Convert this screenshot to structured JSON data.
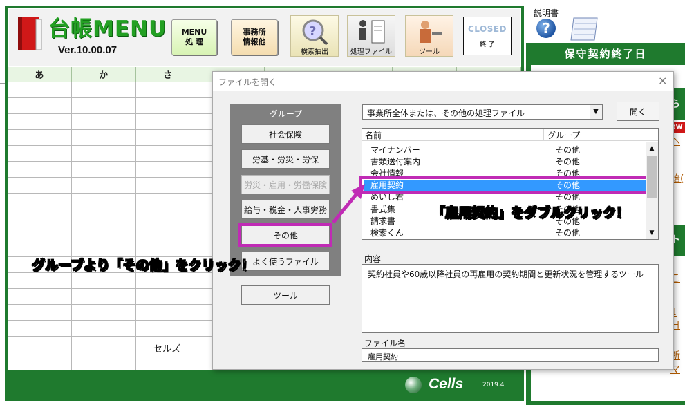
{
  "app": {
    "title": "台帳MENU",
    "version": "Ver.10.00.07"
  },
  "toolbar": {
    "menu_btn_line1": "MENU",
    "menu_btn_line2": "処 理",
    "office_btn_line1": "事務所",
    "office_btn_line2": "情報他",
    "search_label": "検索抽出",
    "process_label": "処理ファイル",
    "tool_label": "ツール",
    "closed_top": "CLOSED",
    "closed_label": "終 了"
  },
  "grid": {
    "columns": [
      "あ",
      "か",
      "さ"
    ],
    "cell_text": "セルズ"
  },
  "footer": {
    "brand": "Cells",
    "year": "2019.4"
  },
  "right": {
    "manual_label": "説明書",
    "panel_title": "保守契約終了日",
    "fragments": [
      "ら",
      "ew",
      "ヘ",
      "始(",
      "ト",
      "こ",
      "1日",
      "新マ"
    ]
  },
  "dialog": {
    "title": "ファイルを開く",
    "close": "×",
    "group_label": "グループ",
    "groups": [
      {
        "label": "社会保険",
        "enabled": true
      },
      {
        "label": "労基・労災・労保",
        "enabled": true
      },
      {
        "label": "労災・雇用・労働保険",
        "enabled": false
      },
      {
        "label": "給与・税金・人事労務",
        "enabled": true
      },
      {
        "label": "その他",
        "enabled": true,
        "selected": true
      },
      {
        "label": "よく使うファイル",
        "enabled": true
      }
    ],
    "tool_btn": "ツール",
    "combo_value": "事業所全体または、その他の処理ファイル",
    "open_btn": "開く",
    "list_headers": {
      "name": "名前",
      "group": "グループ"
    },
    "files": [
      {
        "name": "マイナンバー",
        "group": "その他"
      },
      {
        "name": "書類送付案内",
        "group": "その他"
      },
      {
        "name": "会社情報",
        "group": "その他"
      },
      {
        "name": "雇用契約",
        "group": "その他",
        "selected": true
      },
      {
        "name": "めいし君",
        "group": "その他"
      },
      {
        "name": "書式集",
        "group": "その他"
      },
      {
        "name": "請求書",
        "group": "その他"
      },
      {
        "name": "検索くん",
        "group": "その他"
      }
    ],
    "content_label": "内容",
    "content_text": "契約社員や60歳以降社員の再雇用の契約期間と更新状況を管理するツール",
    "filename_label": "ファイル名",
    "filename_value": "雇用契約"
  },
  "annotations": {
    "left": "グループより「その他」をクリック！",
    "right": "「雇用契約」をダブルクリック！"
  },
  "colors": {
    "frame_green": "#1f7a2e",
    "highlight_magenta": "#c02bb5",
    "selection_blue": "#3399ff"
  }
}
